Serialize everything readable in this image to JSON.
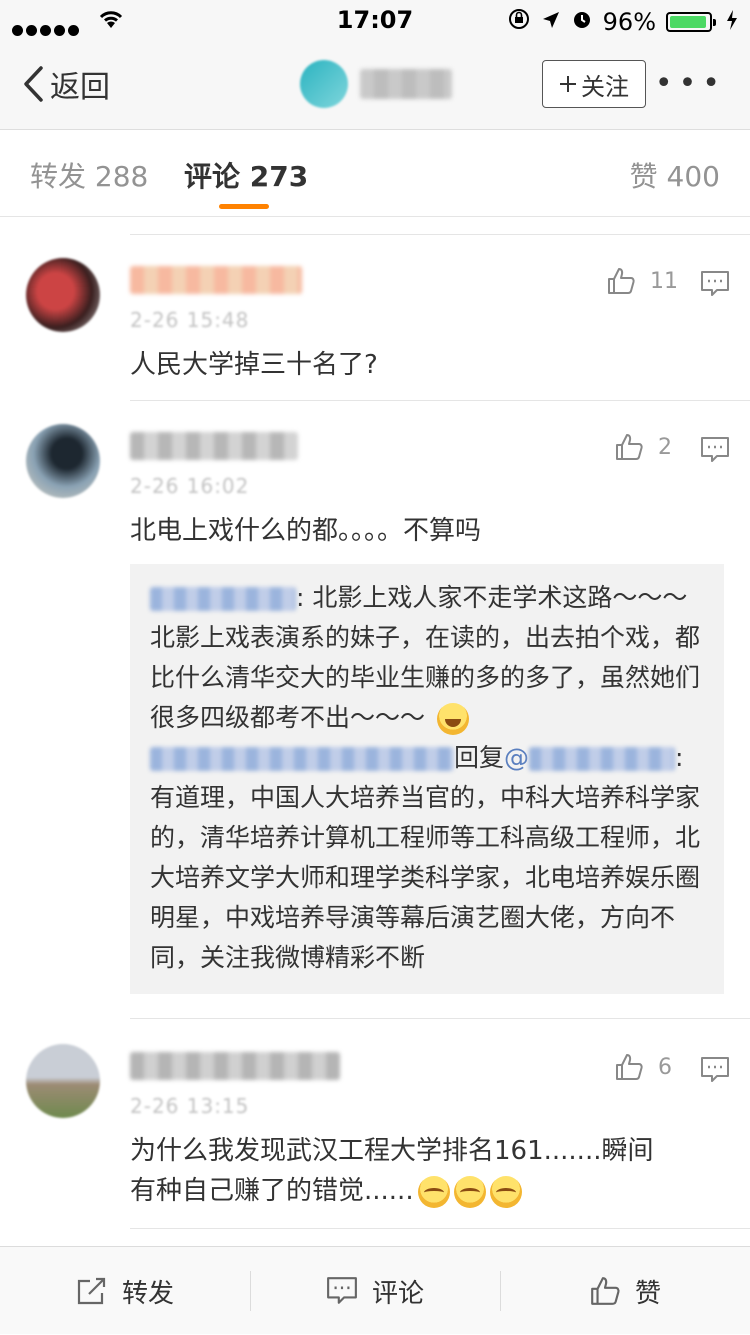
{
  "status": {
    "time": "17:07",
    "battery": "96%"
  },
  "nav": {
    "back_label": "返回",
    "follow_label": "关注"
  },
  "tabs": {
    "repost_label": "转发",
    "repost_count": "288",
    "comment_label": "评论",
    "comment_count": "273",
    "like_label": "赞",
    "like_count": "400"
  },
  "comments": [
    {
      "time": "2-26 15:48",
      "likes": "11",
      "text": "人民大学掉三十名了?"
    },
    {
      "time": "2-26 16:02",
      "likes": "2",
      "text": "北电上戏什么的都。。。。不算吗",
      "replies": [
        {
          "text": ": 北影上戏人家不走学术这路～～～  北影上戏表演系的妹子，在读的，出去拍个戏，都比什么清华交大的毕业生赚的多的多了，虽然她们很多四级都考不出～～～"
        },
        {
          "reply_word": "回复",
          "at": "@",
          "text": ":有道理，中国人大培养当官的，中科大培养科学家的，清华培养计算机工程师等工科高级工程师，北大培养文学大师和理学类科学家，北电培养娱乐圈明星，中戏培养导演等幕后演艺圈大佬，方向不同，关注我微博精彩不断"
        }
      ]
    },
    {
      "time": "2-26 13:15",
      "likes": "6",
      "text_line1": "为什么我发现武汉工程大学排名161.......瞬间",
      "text_line2": "有种自己赚了的错觉......"
    }
  ],
  "bottom": {
    "repost": "转发",
    "comment": "评论",
    "like": "赞"
  },
  "colors": {
    "accent": "#ff8200",
    "battery": "#4cd964",
    "link": "#5a7fbf"
  },
  "icons": [
    "signal-dots-icon",
    "wifi-icon",
    "rotation-lock-icon",
    "location-arrow-icon",
    "alarm-icon",
    "battery-icon",
    "charging-icon",
    "back-chevron-icon",
    "plus-icon",
    "more-icon",
    "thumb-up-icon",
    "comment-bubble-icon",
    "share-icon",
    "laugh-emoji",
    "cry-emoji"
  ]
}
